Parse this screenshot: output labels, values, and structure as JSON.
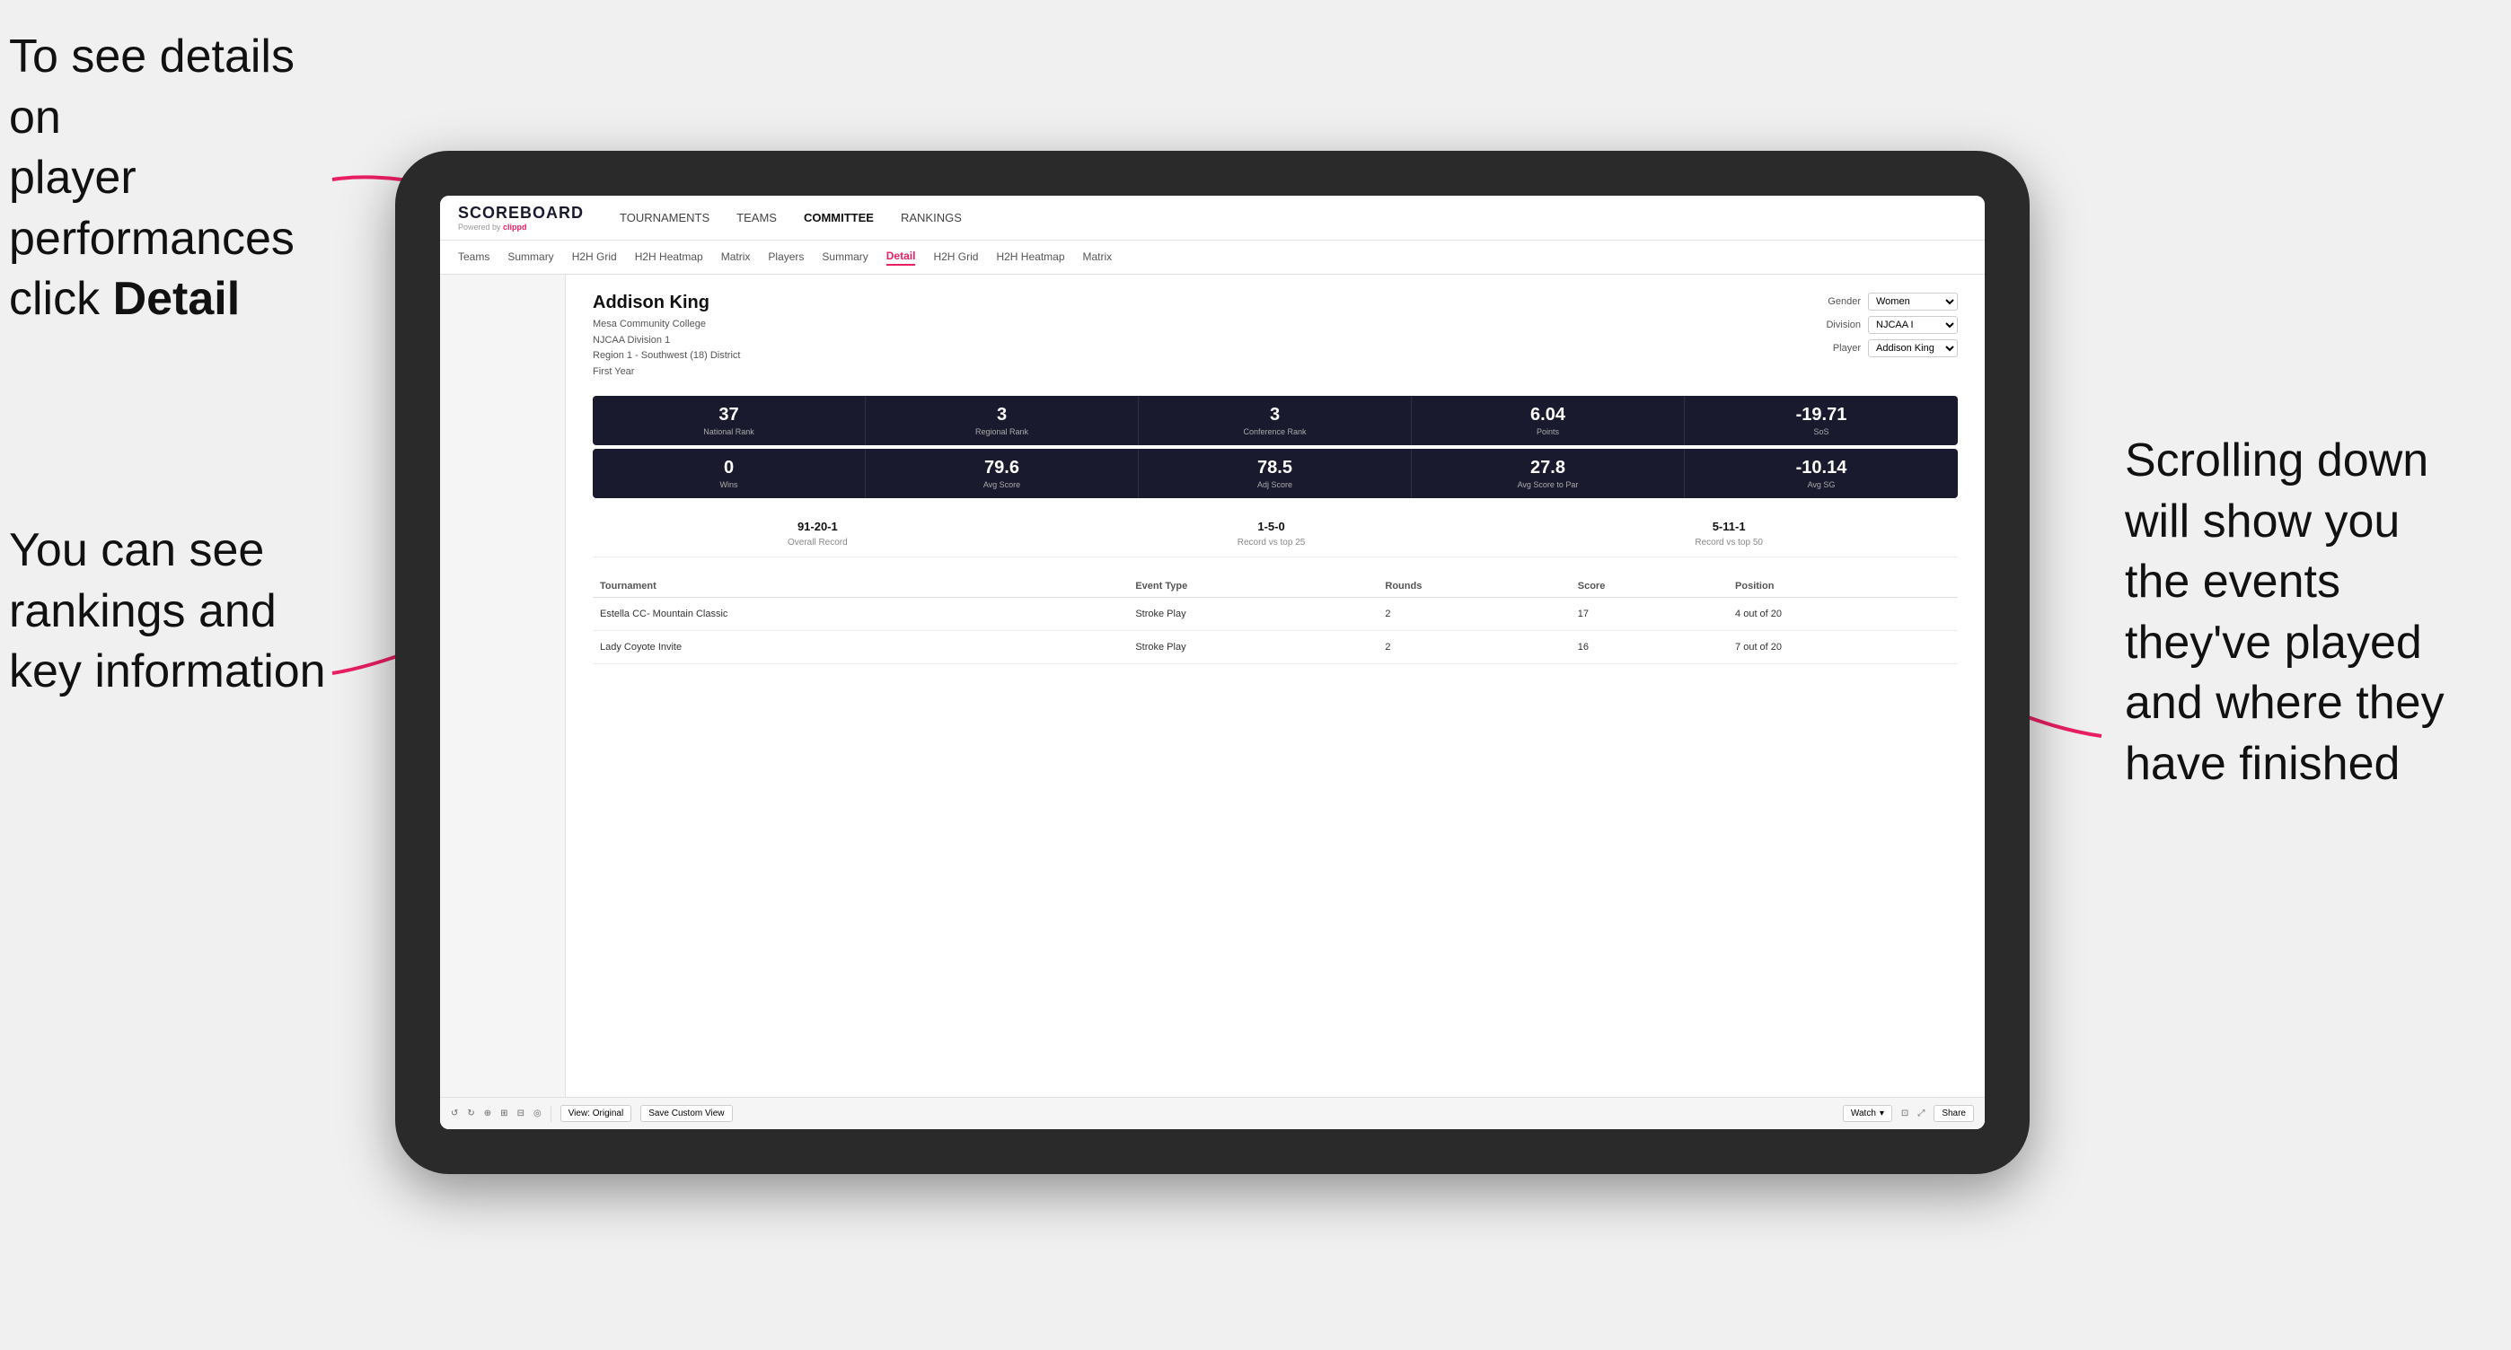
{
  "annotations": {
    "left_top": {
      "line1": "To see details on",
      "line2": "player performances",
      "line3_normal": "click ",
      "line3_bold": "Detail"
    },
    "right": {
      "line1": "Scrolling down",
      "line2": "will show you",
      "line3": "the events",
      "line4": "they've played",
      "line5": "and where they",
      "line6": "have finished"
    },
    "bottom_left": {
      "line1": "You can see",
      "line2": "rankings and",
      "line3": "key information"
    }
  },
  "nav": {
    "logo": "SCOREBOARD",
    "powered_by": "Powered by clippd",
    "main_items": [
      "TOURNAMENTS",
      "TEAMS",
      "COMMITTEE",
      "RANKINGS"
    ],
    "active_main": "COMMITTEE"
  },
  "sub_nav": {
    "items": [
      "Teams",
      "Summary",
      "H2H Grid",
      "H2H Heatmap",
      "Matrix",
      "Players",
      "Summary",
      "Detail",
      "H2H Grid",
      "H2H Heatmap",
      "Matrix"
    ],
    "active": "Detail"
  },
  "player": {
    "name": "Addison King",
    "college": "Mesa Community College",
    "division": "NJCAA Division 1",
    "region": "Region 1 - Southwest (18) District",
    "year": "First Year",
    "gender_label": "Gender",
    "gender_value": "Women",
    "division_label": "Division",
    "division_value": "NJCAA I",
    "player_label": "Player",
    "player_value": "Addison King"
  },
  "stats_row1": [
    {
      "value": "37",
      "label": "National Rank"
    },
    {
      "value": "3",
      "label": "Regional Rank"
    },
    {
      "value": "3",
      "label": "Conference Rank"
    },
    {
      "value": "6.04",
      "label": "Points"
    },
    {
      "value": "-19.71",
      "label": "SoS"
    }
  ],
  "stats_row2": [
    {
      "value": "0",
      "label": "Wins"
    },
    {
      "value": "79.6",
      "label": "Avg Score"
    },
    {
      "value": "78.5",
      "label": "Adj Score"
    },
    {
      "value": "27.8",
      "label": "Avg Score to Par"
    },
    {
      "value": "-10.14",
      "label": "Avg SG"
    }
  ],
  "records": [
    {
      "value": "91-20-1",
      "label": "Overall Record"
    },
    {
      "value": "1-5-0",
      "label": "Record vs top 25"
    },
    {
      "value": "5-11-1",
      "label": "Record vs top 50"
    }
  ],
  "table": {
    "headers": [
      "Tournament",
      "Event Type",
      "Rounds",
      "Score",
      "Position"
    ],
    "rows": [
      {
        "tournament": "Estella CC- Mountain Classic",
        "event_type": "Stroke Play",
        "rounds": "2",
        "score": "17",
        "position": "4 out of 20"
      },
      {
        "tournament": "Lady Coyote Invite",
        "event_type": "Stroke Play",
        "rounds": "2",
        "score": "16",
        "position": "7 out of 20"
      }
    ]
  },
  "toolbar": {
    "undo": "↺",
    "redo": "↻",
    "view_original": "View: Original",
    "save_custom": "Save Custom View",
    "watch": "Watch",
    "share": "Share"
  }
}
